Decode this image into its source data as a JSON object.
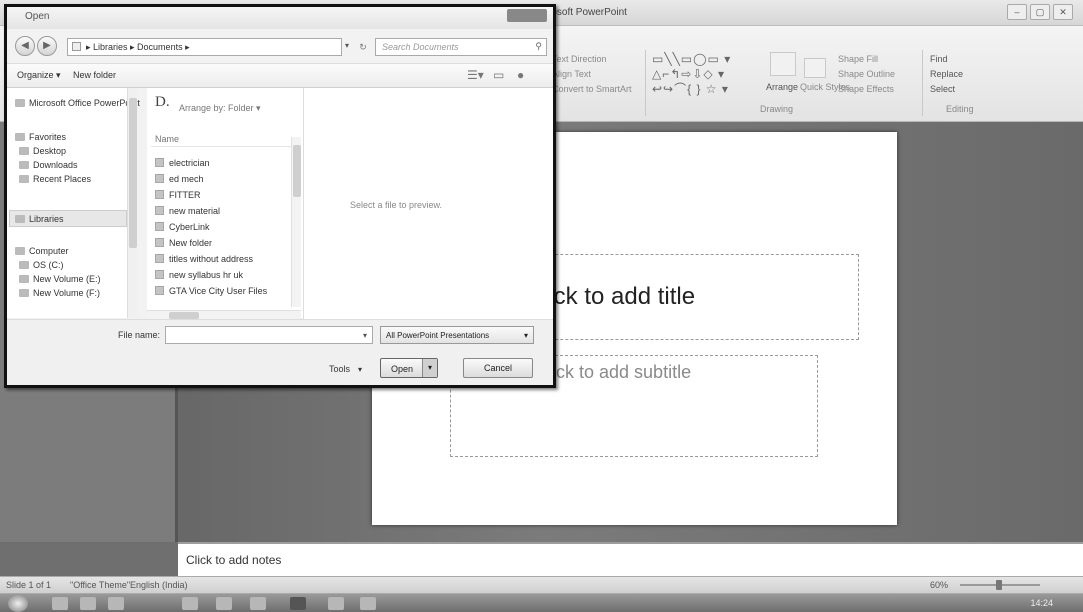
{
  "ppt": {
    "window_title": "rosoft PowerPoint",
    "ribbon": {
      "text_direction": "Text Direction",
      "align_text": "Align Text",
      "convert_smartart": "Convert to SmartArt",
      "arrange": "Arrange",
      "quick_styles": "Quick Styles",
      "shape_fill": "Shape Fill",
      "shape_outline": "Shape Outline",
      "shape_effects": "Shape Effects",
      "drawing_group": "Drawing",
      "find": "Find",
      "replace": "Replace",
      "select": "Select",
      "editing_group": "Editing",
      "shapes_row1": "▭╲╲▭◯▭ ▾",
      "shapes_row2": "△⌐↰⇨⇩◇ ▾",
      "shapes_row3": "↩↪⌒{ } ☆ ▾"
    },
    "slide": {
      "title_placeholder": "lick to add title",
      "subtitle_placeholder": "lick to add subtitle"
    },
    "notes_placeholder": "Click to add notes",
    "status": {
      "slide_counter": "Slide 1 of 1",
      "theme": "\"Office Theme\"",
      "language": "English (India)",
      "zoom": "60%"
    },
    "clock": "14:24"
  },
  "dialog": {
    "title": "Open",
    "address": "▸ Libraries ▸ Documents ▸",
    "search_placeholder": "Search Documents",
    "toolbar": {
      "organize": "Organize ▾",
      "new_folder": "New folder"
    },
    "nav": {
      "office": "Microsoft Office PowerPoint",
      "favorites": "Favorites",
      "desktop": "Desktop",
      "downloads": "Downloads",
      "recent_places": "Recent Places",
      "libraries": "Libraries",
      "computer": "Computer",
      "os_c": "OS (C:)",
      "new_volume_e": "New Volume (E:)",
      "new_volume_f": "New Volume (F:)"
    },
    "library_header": "D.",
    "arrange_by": "Arrange by:  Folder ▾",
    "column_name": "Name",
    "files": [
      "electrician",
      "ed mech",
      "FITTER",
      "new material",
      "CyberLink",
      "New folder",
      "titles without address",
      "new syllabus hr uk",
      "GTA Vice City User Files"
    ],
    "preview_text": "Select a file to preview.",
    "filename_label": "File name:",
    "filetype": "All PowerPoint Presentations",
    "tools": "Tools",
    "open": "Open",
    "cancel": "Cancel"
  }
}
